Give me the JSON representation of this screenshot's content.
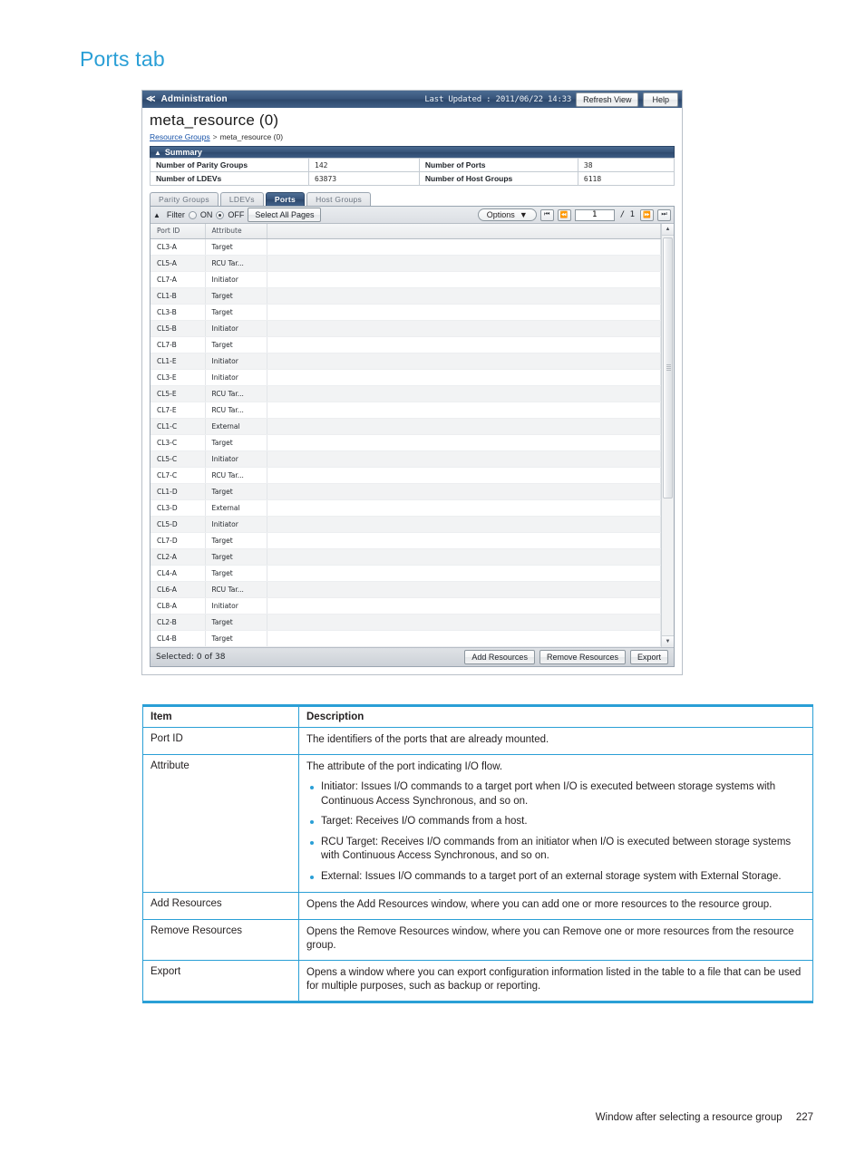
{
  "page": {
    "title": "Ports tab",
    "footer_text": "Window after selecting a resource group",
    "footer_page": "227"
  },
  "app": {
    "titlebar": {
      "back_chevron": "≪",
      "title": "Administration",
      "last_updated": "Last Updated : 2011/06/22 14:33",
      "refresh_label": "Refresh View",
      "help_label": "Help"
    },
    "resource": {
      "name": "meta_resource (0)",
      "breadcrumb_root": "Resource Groups",
      "breadcrumb_sep": ">",
      "breadcrumb_current": "meta_resource (0)"
    },
    "summary": {
      "title": "Summary",
      "rows": [
        {
          "label1": "Number of Parity Groups",
          "value1": "142",
          "label2": "Number of Ports",
          "value2": "38"
        },
        {
          "label1": "Number of LDEVs",
          "value1": "63873",
          "label2": "Number of Host Groups",
          "value2": "6118"
        }
      ]
    },
    "tabs": [
      {
        "label": "Parity Groups",
        "active": false
      },
      {
        "label": "LDEVs",
        "active": false
      },
      {
        "label": "Ports",
        "active": true
      },
      {
        "label": "Host Groups",
        "active": false
      }
    ],
    "toolbar": {
      "filter_label": "Filter",
      "on_label": "ON",
      "off_label": "OFF",
      "select_all_label": "Select All Pages",
      "options_label": "Options",
      "page_value": "1",
      "page_total": "/ 1",
      "nav_first": "⏮",
      "nav_prev": "⏪",
      "nav_next": "⏩",
      "nav_last": "⏭"
    },
    "table": {
      "columns": [
        "Port ID",
        "Attribute"
      ],
      "rows": [
        {
          "port_id": "CL3-A",
          "attribute": "Target"
        },
        {
          "port_id": "CL5-A",
          "attribute": "RCU Tar..."
        },
        {
          "port_id": "CL7-A",
          "attribute": "Initiator"
        },
        {
          "port_id": "CL1-B",
          "attribute": "Target"
        },
        {
          "port_id": "CL3-B",
          "attribute": "Target"
        },
        {
          "port_id": "CL5-B",
          "attribute": "Initiator"
        },
        {
          "port_id": "CL7-B",
          "attribute": "Target"
        },
        {
          "port_id": "CL1-E",
          "attribute": "Initiator"
        },
        {
          "port_id": "CL3-E",
          "attribute": "Initiator"
        },
        {
          "port_id": "CL5-E",
          "attribute": "RCU Tar..."
        },
        {
          "port_id": "CL7-E",
          "attribute": "RCU Tar..."
        },
        {
          "port_id": "CL1-C",
          "attribute": "External"
        },
        {
          "port_id": "CL3-C",
          "attribute": "Target"
        },
        {
          "port_id": "CL5-C",
          "attribute": "Initiator"
        },
        {
          "port_id": "CL7-C",
          "attribute": "RCU Tar..."
        },
        {
          "port_id": "CL1-D",
          "attribute": "Target"
        },
        {
          "port_id": "CL3-D",
          "attribute": "External"
        },
        {
          "port_id": "CL5-D",
          "attribute": "Initiator"
        },
        {
          "port_id": "CL7-D",
          "attribute": "Target"
        },
        {
          "port_id": "CL2-A",
          "attribute": "Target"
        },
        {
          "port_id": "CL4-A",
          "attribute": "Target"
        },
        {
          "port_id": "CL6-A",
          "attribute": "RCU Tar..."
        },
        {
          "port_id": "CL8-A",
          "attribute": "Initiator"
        },
        {
          "port_id": "CL2-B",
          "attribute": "Target"
        },
        {
          "port_id": "CL4-B",
          "attribute": "Target"
        }
      ]
    },
    "statusbar": {
      "selected_text": "Selected:  0   of  38",
      "add_label": "Add Resources",
      "remove_label": "Remove Resources",
      "export_label": "Export"
    }
  },
  "description_table": {
    "headers": [
      "Item",
      "Description"
    ],
    "rows": [
      {
        "item": "Port ID",
        "text": "The identifiers of the ports that are already mounted.",
        "bullets": []
      },
      {
        "item": "Attribute",
        "text": "The attribute of the port indicating I/O flow.",
        "bullets": [
          "Initiator: Issues I/O commands to a target port when I/O is executed between storage systems with Continuous Access Synchronous, and so on.",
          "Target: Receives I/O commands from a host.",
          "RCU Target: Receives I/O commands from an initiator when I/O is executed between storage systems with Continuous Access Synchronous, and so on.",
          "External: Issues I/O commands to a target port of an external storage system with External Storage."
        ]
      },
      {
        "item": "Add Resources",
        "text": "Opens the Add Resources window, where you can add one or more resources to the resource group.",
        "bullets": []
      },
      {
        "item": "Remove Resources",
        "text": "Opens the Remove Resources window, where you can Remove one or more resources from the resource group.",
        "bullets": []
      },
      {
        "item": "Export",
        "text": "Opens a window where you can export configuration information listed in the table to a file that can be used for multiple purposes, such as backup or reporting.",
        "bullets": []
      }
    ]
  },
  "colors": {
    "accent": "#2a9fd6",
    "titlebar": "#36537a",
    "link": "#1752a8"
  }
}
